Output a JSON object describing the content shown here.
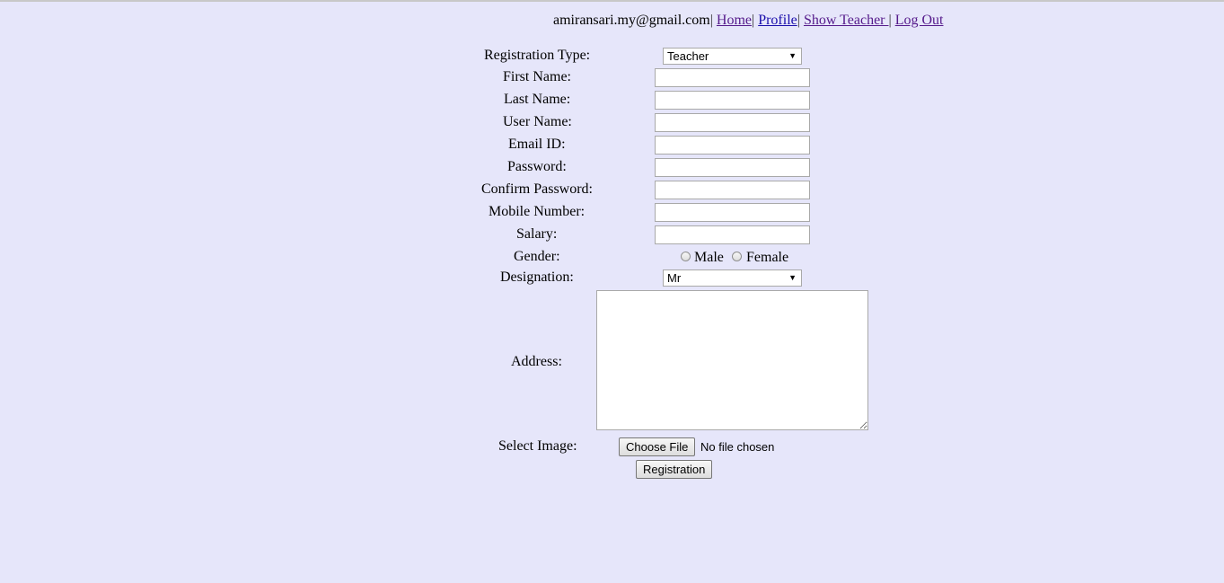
{
  "header": {
    "email": "amiransari.my@gmail.com",
    "separator": "|",
    "links": {
      "home": "Home",
      "profile": "Profile",
      "show_teacher": "Show Teacher ",
      "logout": "Log Out"
    }
  },
  "form": {
    "registration_type": {
      "label": "Registration Type:",
      "value": "Teacher"
    },
    "first_name": {
      "label": "First Name:",
      "value": ""
    },
    "last_name": {
      "label": "Last Name:",
      "value": ""
    },
    "user_name": {
      "label": "User Name:",
      "value": ""
    },
    "email_id": {
      "label": "Email ID:",
      "value": ""
    },
    "password": {
      "label": "Password:",
      "value": ""
    },
    "confirm_password": {
      "label": "Confirm Password:",
      "value": ""
    },
    "mobile_number": {
      "label": "Mobile Number:",
      "value": ""
    },
    "salary": {
      "label": "Salary:",
      "value": ""
    },
    "gender": {
      "label": "Gender:",
      "options": [
        "Male",
        "Female"
      ],
      "selected": null
    },
    "designation": {
      "label": "Designation:",
      "value": "Mr"
    },
    "address": {
      "label": "Address:",
      "value": ""
    },
    "select_image": {
      "label": "Select Image:",
      "button": "Choose File",
      "status": "No file chosen"
    },
    "submit": "Registration"
  },
  "icons": {
    "select_arrow": "▼"
  }
}
